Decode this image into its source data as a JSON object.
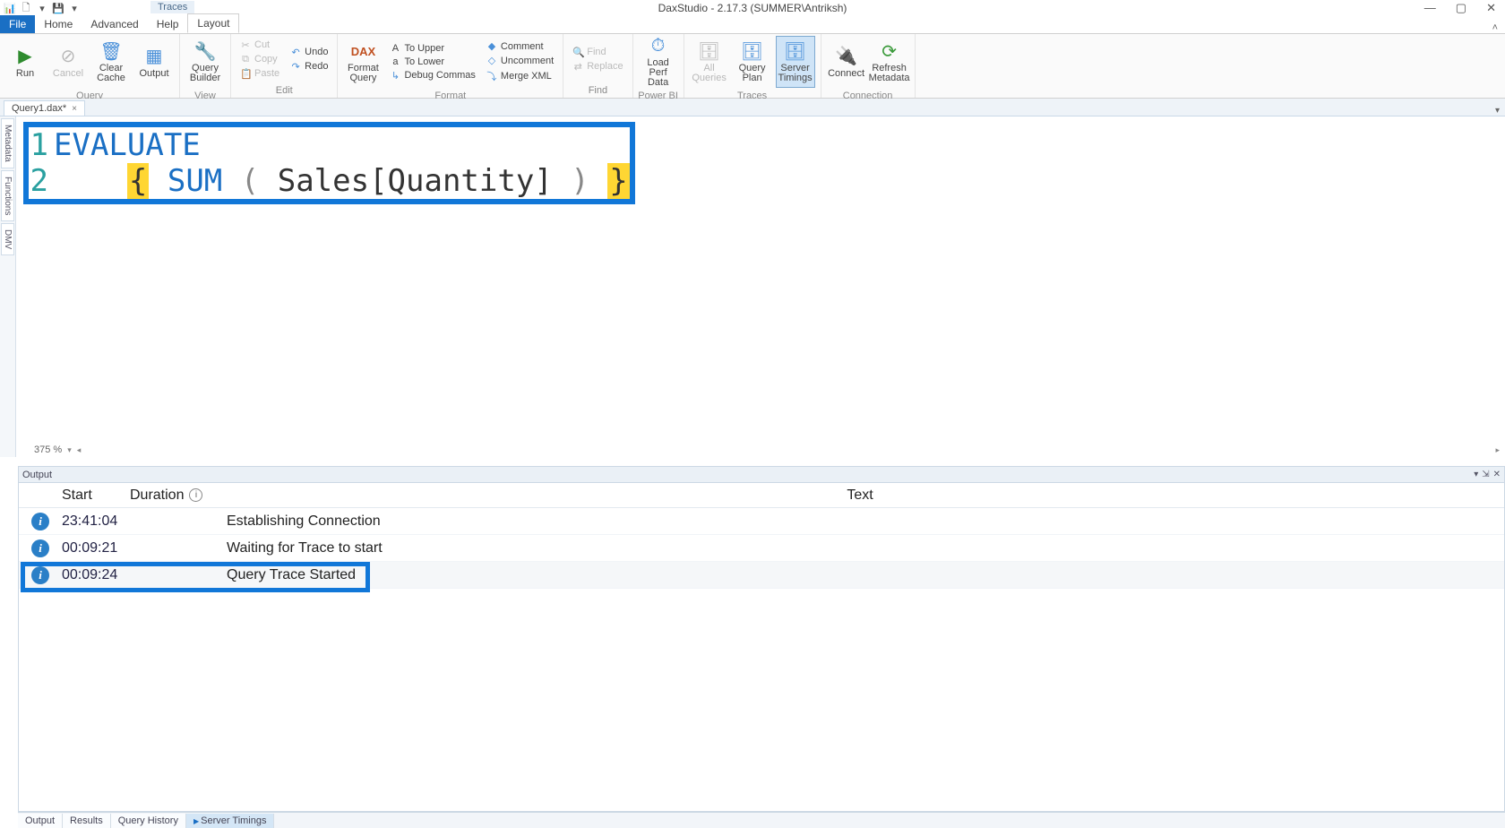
{
  "window": {
    "title": "DaxStudio - 2.17.3 (SUMMER\\Antriksh)",
    "minimize": "—",
    "maximize": "▢",
    "close": "✕"
  },
  "context_tab": "Traces",
  "tabs": {
    "file": "File",
    "home": "Home",
    "advanced": "Advanced",
    "help": "Help",
    "layout": "Layout"
  },
  "ribbon": {
    "run": "Run",
    "cancel": "Cancel",
    "clear_cache": "Clear Cache",
    "output": "Output",
    "query_builder": "Query Builder",
    "cut": "Cut",
    "copy": "Copy",
    "paste": "Paste",
    "undo": "Undo",
    "redo": "Redo",
    "dax_format": "Format Query",
    "to_upper": "To Upper",
    "to_lower": "To Lower",
    "debug_commas": "Debug Commas",
    "comment": "Comment",
    "uncomment": "Uncomment",
    "merge_xml": "Merge XML",
    "find": "Find",
    "replace": "Replace",
    "load_perf": "Load Perf Data",
    "all_queries": "All Queries",
    "query_plan": "Query Plan",
    "server_timings": "Server Timings",
    "connect": "Connect",
    "refresh_meta": "Refresh Metadata",
    "g_query": "Query",
    "g_view": "View",
    "g_edit": "Edit",
    "g_format": "Format",
    "g_find": "Find",
    "g_powerbi": "Power BI",
    "g_traces": "Traces",
    "g_conn": "Connection"
  },
  "doc_tab": {
    "name": "Query1.dax*",
    "close": "×"
  },
  "side_tabs": {
    "metadata": "Metadata",
    "functions": "Functions",
    "dmv": "DMV"
  },
  "code": {
    "l1_num": "1",
    "l1_evaluate": "EVALUATE",
    "l2_num": "2",
    "l2_indent": "    ",
    "l2_lb": "{",
    "l2_sp1": " ",
    "l2_sum": "SUM",
    "l2_sp2": " ",
    "l2_lp": "(",
    "l2_sp3": " ",
    "l2_ref": "Sales[Quantity]",
    "l2_sp4": " ",
    "l2_rp": ")",
    "l2_sp5": " ",
    "l2_rb": "}"
  },
  "editor": {
    "zoom": "375 %",
    "left": "◂",
    "right": "▸"
  },
  "output": {
    "title": "Output",
    "ctrl_down": "▾",
    "ctrl_pin": "⇲",
    "ctrl_close": "✕",
    "col_start": "Start",
    "col_dur": "Duration",
    "col_text": "Text",
    "rows": [
      {
        "start": "23:41:04",
        "dur": "",
        "text": "Establishing Connection"
      },
      {
        "start": "00:09:21",
        "dur": "",
        "text": "Waiting for Trace to start"
      },
      {
        "start": "00:09:24",
        "dur": "",
        "text": "Query Trace Started"
      }
    ]
  },
  "bottom_tabs": {
    "output": "Output",
    "results": "Results",
    "history": "Query History",
    "timings": "Server Timings"
  }
}
